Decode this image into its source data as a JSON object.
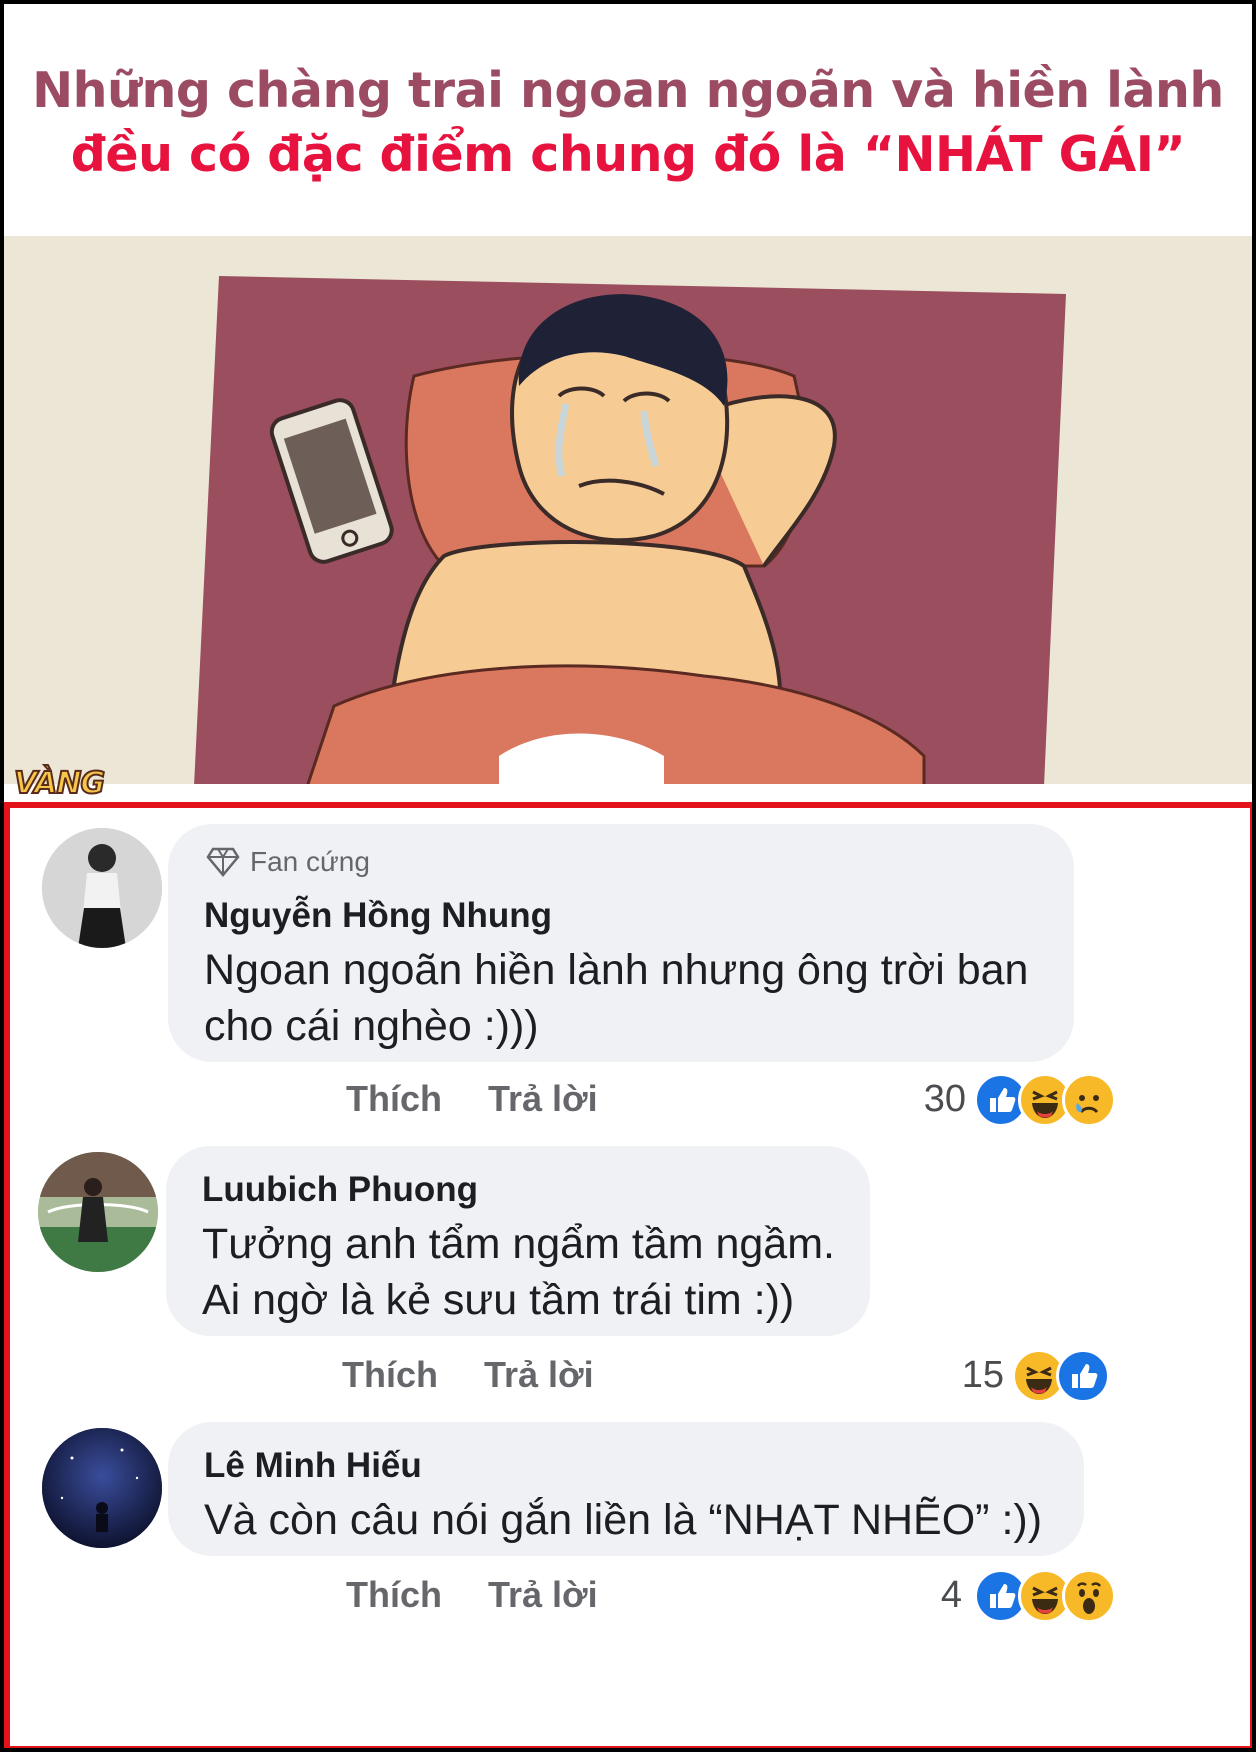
{
  "header": {
    "line1": "Những chàng trai ngoan ngoãn và hiền lành",
    "line2": "đều có đặc điểm chung đó là “NHÁT GÁI”"
  },
  "watermark": "VÀNG",
  "colors": {
    "title_top": "#9b4b62",
    "title_bottom": "#e8123f",
    "highlight_border": "#e3121b",
    "like_blue": "#1b74e4",
    "bubble_bg": "#eff1f4"
  },
  "comments": [
    {
      "badge": "Fan cứng",
      "badge_icon": "diamond-icon",
      "name": "Nguyễn Hồng Nhung",
      "lines": [
        "Ngoan ngoãn hiền lành nhưng ông trời ban",
        "cho cái nghèo :)))"
      ],
      "like_label": "Thích",
      "reply_label": "Trả lời",
      "reaction_count": "30",
      "reactions": [
        "like-icon",
        "haha-icon",
        "sad-icon"
      ]
    },
    {
      "name": "Luubich Phuong",
      "lines": [
        "Tưởng anh tẩm ngẩm tầm ngầm.",
        "Ai ngờ là kẻ sưu tầm trái tim :))"
      ],
      "like_label": "Thích",
      "reply_label": "Trả lời",
      "reaction_count": "15",
      "reactions": [
        "haha-icon",
        "like-icon"
      ]
    },
    {
      "name": "Lê Minh Hiếu",
      "lines": [
        "Và còn câu nói gắn liền là “NHẠT NHẼO” :))"
      ],
      "like_label": "Thích",
      "reply_label": "Trả lời",
      "reaction_count": "4",
      "reactions": [
        "like-icon",
        "haha-icon",
        "wow-icon"
      ]
    }
  ]
}
